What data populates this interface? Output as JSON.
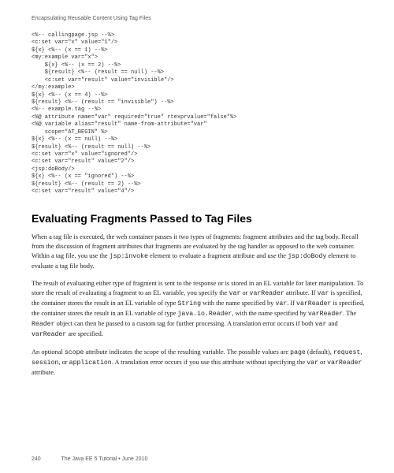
{
  "header": {
    "chapter": "Encapsulating Reusable Content Using Tag Files"
  },
  "code": {
    "lines": [
      "<%-- callingpage.jsp --%>",
      "<c:set var=\"x\" value=\"1\"/>",
      "${x} <%-- (x == 1) --%>",
      "<my:example var=\"x\">",
      "    ${x} <%-- (x == 2) --%>",
      "    ${result} <%-- (result == null) --%>",
      "    <c:set var=\"result\" value=\"invisible\"/>",
      "</my:example>",
      "${x} <%-- (x == 4) --%>",
      "${result} <%-- (result == \"invisible\") --%>",
      "<%-- example.tag --%>",
      "<%@ attribute name=\"var\" required=\"true\" rtexprvalue=\"false\"%>",
      "<%@ variable alias=\"result\" name-from-attribute=\"var\"",
      "    scope=\"AT_BEGIN\" %>",
      "${x} <%-- (x == null) --%>",
      "${result} <%-- (result == null) --%>",
      "<c:set var=\"x\" value=\"ignored\"/>",
      "<c:set var=\"result\" value=\"2\"/>",
      "<jsp:doBody/>",
      "${x} <%-- (x == \"ignored\") --%>",
      "${result} <%-- (result == 2) --%>",
      "<c:set var=\"result\" value=\"4\"/>"
    ]
  },
  "section": {
    "title": "Evaluating Fragments Passed to Tag Files"
  },
  "paragraphs": {
    "p1_a": "When a tag file is executed, the web container passes it two types of fragments: fragment attributes and the tag body. Recall from the discussion of fragment attributes that fragments are evaluated by the tag handler as opposed to the web container. Within a tag file, you use the ",
    "p1_code1": "jsp:invoke",
    "p1_b": " element to evaluate a fragment attribute and use the ",
    "p1_code2": "jsp:doBody",
    "p1_c": " element to evaluate a tag file body.",
    "p2_a": "The result of evaluating either type of fragment is sent to the response or is stored in an EL variable for later manipulation. To store the result of evaluating a fragment to an EL variable, you specify the ",
    "p2_code1": "var",
    "p2_b": " or ",
    "p2_code2": "varReader",
    "p2_c": " attribute. If ",
    "p2_code3": "var",
    "p2_d": " is specified, the container stores the result in an EL variable of type ",
    "p2_code4": "String",
    "p2_e": " with the name specified by ",
    "p2_code5": "var",
    "p2_f": ". If ",
    "p2_code6": "varReader",
    "p2_g": " is specified, the container stores the result in an EL variable of type ",
    "p2_code7": "java.io.Reader",
    "p2_h": ", with the name specified by ",
    "p2_code8": "varReader",
    "p2_i": ". The ",
    "p2_code9": "Reader",
    "p2_j": " object can then be passed to a custom tag for further processing. A translation error occurs if both ",
    "p2_code10": "var",
    "p2_k": " and ",
    "p2_code11": "varReader",
    "p2_l": " are specified.",
    "p3_a": "An optional ",
    "p3_code1": "scope",
    "p3_b": " attribute indicates the scope of the resulting variable. The possible values are ",
    "p3_code2": "page",
    "p3_c": " (default), ",
    "p3_code3": "request",
    "p3_d": ", ",
    "p3_code4": "session",
    "p3_e": ", or ",
    "p3_code5": "application",
    "p3_f": ". A translation error occurs if you use this attribute without specifying the ",
    "p3_code6": "var",
    "p3_g": " or ",
    "p3_code7": "varReader",
    "p3_h": " attribute."
  },
  "footer": {
    "page": "240",
    "book": "The Java EE 5 Tutorial • June 2010"
  }
}
